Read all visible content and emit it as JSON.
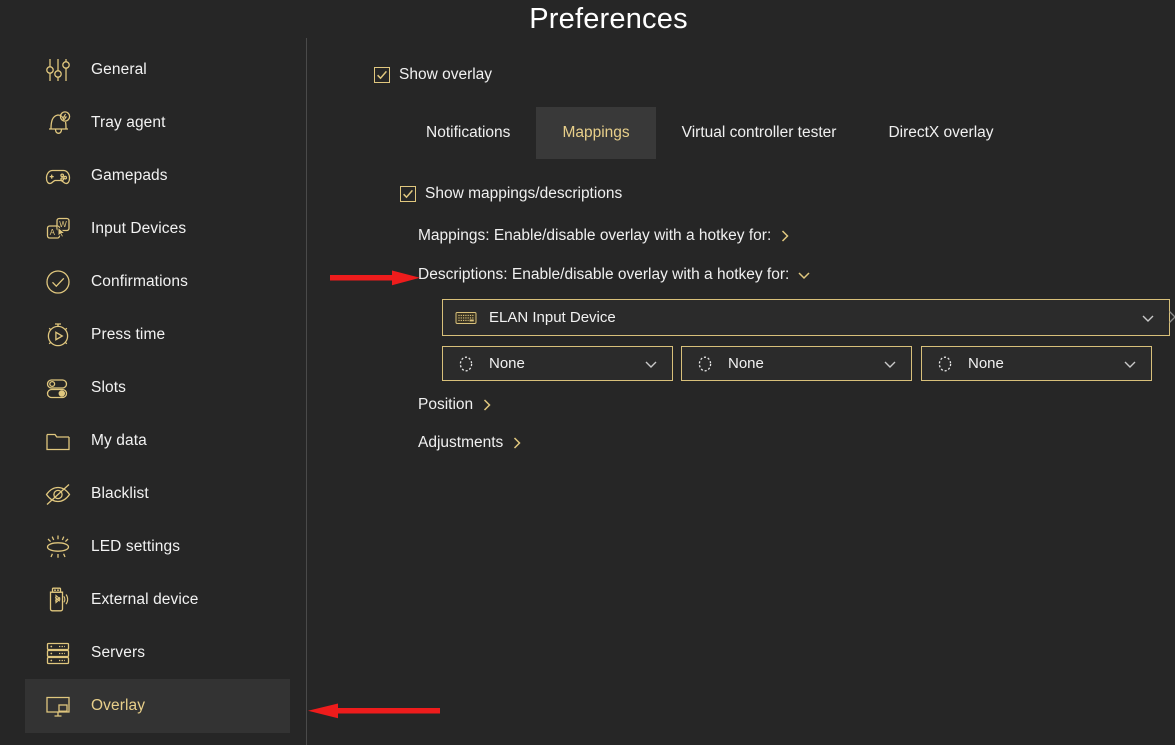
{
  "window": {
    "background_color": "#262626",
    "accent_color": "#e8cf8a",
    "annotation_color": "#ee1c1c"
  },
  "sidebar": {
    "items": [
      {
        "label": "General",
        "icon": "sliders-icon",
        "selected": false
      },
      {
        "label": "Tray agent",
        "icon": "bell-bolt-icon",
        "selected": false
      },
      {
        "label": "Gamepads",
        "icon": "gamepad-icon",
        "selected": false
      },
      {
        "label": "Input Devices",
        "icon": "keyboard-cursor-icon",
        "selected": false
      },
      {
        "label": "Confirmations",
        "icon": "check-circle-icon",
        "selected": false
      },
      {
        "label": "Press time",
        "icon": "stopwatch-play-icon",
        "selected": false
      },
      {
        "label": "Slots",
        "icon": "toggles-icon",
        "selected": false
      },
      {
        "label": "My data",
        "icon": "folder-icon",
        "selected": false
      },
      {
        "label": "Blacklist",
        "icon": "eye-slash-icon",
        "selected": false
      },
      {
        "label": "LED settings",
        "icon": "led-light-icon",
        "selected": false
      },
      {
        "label": "External device",
        "icon": "usb-bluetooth-icon",
        "selected": false
      },
      {
        "label": "Servers",
        "icon": "servers-icon",
        "selected": false
      },
      {
        "label": "Overlay",
        "icon": "monitor-overlay-icon",
        "selected": true
      }
    ]
  },
  "header": {
    "title": "Preferences"
  },
  "main": {
    "show_overlay": {
      "label": "Show overlay",
      "checked": true,
      "icon": "checkmark-icon"
    },
    "tabs": [
      {
        "label": "Notifications",
        "active": false
      },
      {
        "label": "Mappings",
        "active": true
      },
      {
        "label": "Virtual controller tester",
        "active": false
      },
      {
        "label": "DirectX overlay",
        "active": false
      }
    ],
    "show_mappings": {
      "label": "Show mappings/descriptions",
      "checked": true,
      "icon": "checkmark-icon"
    },
    "rows": {
      "mappings_hotkey": {
        "label": "Mappings: Enable/disable overlay with a hotkey for:",
        "chevron": "chevron-right-icon",
        "expanded": false
      },
      "descriptions_hotkey": {
        "label": "Descriptions: Enable/disable overlay with a hotkey for:",
        "chevron": "chevron-down-icon",
        "expanded": true
      },
      "position": {
        "label": "Position",
        "chevron": "chevron-right-icon"
      },
      "adjustments": {
        "label": "Adjustments",
        "chevron": "chevron-right-icon"
      }
    },
    "device_combo": {
      "value": "ELAN Input Device",
      "icon": "keyboard-icon",
      "chevron": "chevron-down-icon"
    },
    "clear_device": {
      "icon": "close-icon"
    },
    "hotkey_combos": [
      {
        "value": "None",
        "icon": "dashed-circle-icon",
        "chevron": "chevron-down-icon"
      },
      {
        "value": "None",
        "icon": "dashed-circle-icon",
        "chevron": "chevron-down-icon"
      },
      {
        "value": "None",
        "icon": "dashed-circle-icon",
        "chevron": "chevron-down-icon"
      }
    ]
  },
  "annotations": [
    {
      "name": "arrow-to-descriptions",
      "direction": "right"
    },
    {
      "name": "arrow-to-overlay",
      "direction": "left"
    }
  ]
}
